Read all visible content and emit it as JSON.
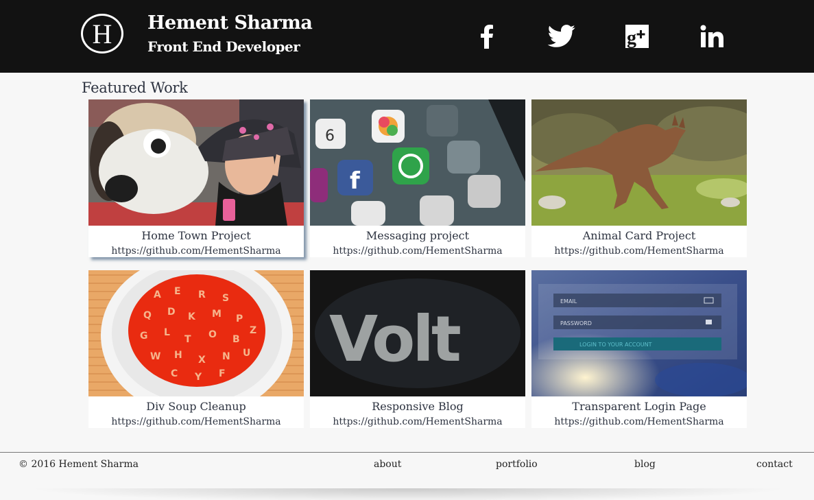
{
  "header": {
    "logo_letter": "H",
    "name": "Hement Sharma",
    "role": "Front End Developer",
    "social": [
      {
        "icon": "facebook-icon"
      },
      {
        "icon": "twitter-icon"
      },
      {
        "icon": "google-plus-icon"
      },
      {
        "icon": "linkedin-icon"
      }
    ]
  },
  "main": {
    "section_title": "Featured Work",
    "projects": [
      {
        "title": "Home Town Project",
        "url": "https://github.com/HementSharma",
        "image": "girl-with-plush-dog-image"
      },
      {
        "title": "Messaging project",
        "url": "https://github.com/HementSharma",
        "image": "phone-apps-image"
      },
      {
        "title": "Animal Card Project",
        "url": "https://github.com/HementSharma",
        "image": "kangaroo-image"
      },
      {
        "title": "Div Soup Cleanup",
        "url": "https://github.com/HementSharma",
        "image": "alphabet-soup-image"
      },
      {
        "title": "Responsive Blog",
        "url": "https://github.com/HementSharma",
        "image": "volt-text-image"
      },
      {
        "title": "Transparent Login Page",
        "url": "https://github.com/HementSharma",
        "image": "login-form-image"
      }
    ]
  },
  "login_mock": {
    "email_label": "EMAIL",
    "password_label": "PASSWORD",
    "button_label": "LOGIN TO YOUR ACCOUNT"
  },
  "volt_text": "Volt",
  "footer": {
    "copyright": "© 2016 Hement Sharma",
    "links": [
      "about",
      "portfolio",
      "blog",
      "contact"
    ]
  },
  "colors": {
    "header_bg": "#121212",
    "page_bg": "#f7f7f7",
    "text": "#2d3340"
  }
}
